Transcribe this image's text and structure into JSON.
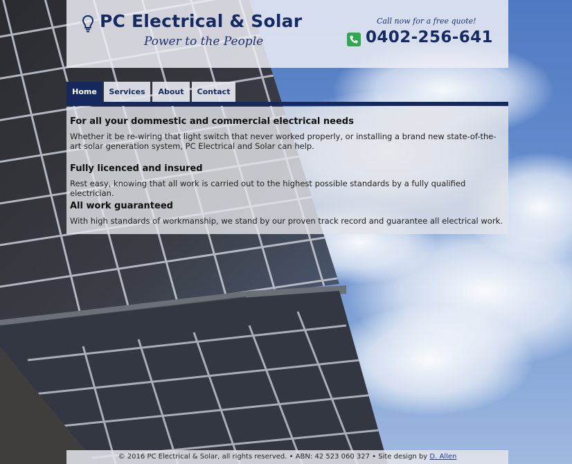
{
  "header": {
    "title": "PC Electrical & Solar",
    "tagline": "Power to the People",
    "call_note": "Call now for a free quote!",
    "phone": "0402-256-641",
    "logo_icon": "lightbulb-icon",
    "phone_icon": "phone-icon"
  },
  "nav": {
    "tabs": [
      {
        "label": "Home",
        "active": true
      },
      {
        "label": "Services",
        "active": false
      },
      {
        "label": "About",
        "active": false
      },
      {
        "label": "Contact",
        "active": false
      }
    ]
  },
  "sections": [
    {
      "heading": "For all your dommestic and commercial electrical needs",
      "text": "Whether it be re-wiring that light switch that never worked properly, or installing a brand new state-of-the-art solar generation system, PC Electrical and Solar can help."
    },
    {
      "heading": "Fully licenced and insured",
      "text": "Rest easy, knowing that all work is carried out to the highest possible standards by a fully qualified electrician."
    },
    {
      "heading": "All work guaranteed",
      "text": "With high standards of workmanship, we stand by our proven track record and guarantee all electrical work."
    }
  ],
  "footer": {
    "text": "© 2016 PC Electrical & Solar, all rights reserved. • ABN: 42 523 060 327 • Site design by",
    "link_text": "D. Allen"
  },
  "colors": {
    "brand_navy": "#15295e",
    "phone_green": "#2fa84f",
    "sky_blue": "#5f86c8"
  }
}
